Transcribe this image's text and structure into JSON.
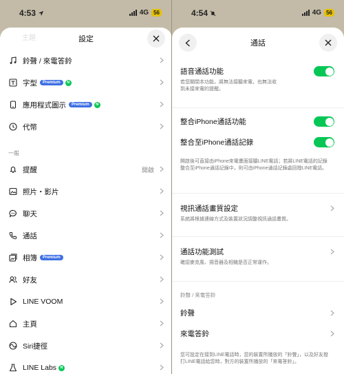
{
  "left": {
    "status": {
      "time": "4:53",
      "network": "4G",
      "battery": "56"
    },
    "ghost_label": "主題",
    "header": {
      "title": "設定"
    },
    "premium_badge": "Premium",
    "new_badge": "N",
    "items_top": [
      {
        "label": "鈴聲 / 來電答鈴",
        "icon": "music-note-icon"
      },
      {
        "label": "字型",
        "icon": "font-icon"
      },
      {
        "label": "應用程式圖示",
        "icon": "app-icon"
      },
      {
        "label": "代幣",
        "icon": "coin-icon"
      }
    ],
    "section_general": "一般",
    "items": [
      {
        "label": "提醒",
        "value": "開啟",
        "icon": "bell-icon"
      },
      {
        "label": "照片・影片",
        "icon": "photo-icon"
      },
      {
        "label": "聊天",
        "icon": "chat-icon"
      },
      {
        "label": "通話",
        "icon": "phone-icon"
      },
      {
        "label": "相簿",
        "icon": "album-icon"
      },
      {
        "label": "好友",
        "icon": "friends-icon"
      },
      {
        "label": "LINE VOOM",
        "icon": "voom-icon"
      },
      {
        "label": "主頁",
        "icon": "home-icon"
      },
      {
        "label": "Siri捷徑",
        "icon": "siri-icon"
      },
      {
        "label": "LINE Labs",
        "icon": "flask-icon"
      }
    ]
  },
  "right": {
    "status": {
      "time": "4:54",
      "network": "4G",
      "battery": "56"
    },
    "header": {
      "title": "通話"
    },
    "voice_call": {
      "title": "語音通話功能",
      "desc": "若您關閉本功能，將無法接聽來電，也無法收到未接來電的提醒。",
      "enabled": true
    },
    "iphone_integration": {
      "title": "整合iPhone通話功能",
      "enabled": true
    },
    "iphone_history": {
      "title": "整合至iPhone通話記錄",
      "enabled": true,
      "desc": "開啟後可直接由iPhone來電畫面接聽LINE電話；若將LINE電話的記錄整合至iPhone通話記錄中，則可由iPhone通話記錄處回撥LINE電話。"
    },
    "video_quality": {
      "title": "視訊通話畫質設定",
      "desc": "系統將根據連線方式及裝置狀況調整視訊通話畫質。"
    },
    "test": {
      "title": "通話功能測試",
      "desc": "確認麥克風、揚音器及相機是否正常運作。"
    },
    "ringtone_section": "鈴聲 / 來電答鈴",
    "ringtone": "鈴聲",
    "ringback": "來電答鈴",
    "footer": "您可設定在接到LINE電話時，您的裝置所播放的「鈴聲」，以及好友撥打LINE電話給您時，對方的裝置所播放的「來電答鈴」。"
  },
  "colors": {
    "accent_green": "#06c755",
    "premium_blue": "#3d6fe3",
    "battery_yellow": "#e6c100"
  }
}
